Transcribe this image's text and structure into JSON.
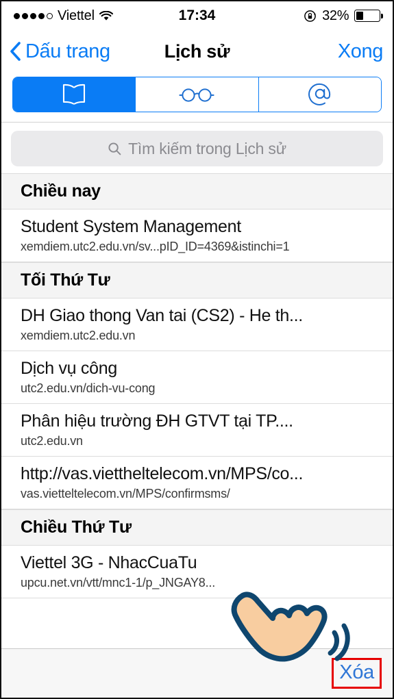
{
  "status_bar": {
    "signal_dots_filled": 4,
    "signal_dots_total": 5,
    "carrier": "Viettel",
    "wifi_icon": "wifi-icon",
    "time": "17:34",
    "rotation_lock_icon": "rotation-lock-icon",
    "battery_percent_label": "32%",
    "battery_level": 32
  },
  "nav_bar": {
    "back_label": "Dấu trang",
    "back_icon": "chevron-left-icon",
    "title": "Lịch sử",
    "done_label": "Xong"
  },
  "segmented_control": {
    "selected_index": 0,
    "accent_color": "#0a7cf5",
    "segments": [
      {
        "icon": "book-icon",
        "name": "bookmarks"
      },
      {
        "icon": "glasses-icon",
        "name": "reading-list"
      },
      {
        "icon": "at-sign-icon",
        "name": "shared-links"
      }
    ]
  },
  "search": {
    "icon": "search-icon",
    "placeholder": "Tìm kiếm trong Lịch sử",
    "value": ""
  },
  "history": {
    "sections": [
      {
        "header": "Chiều nay",
        "items": [
          {
            "title": "Student System Management",
            "url": "xemdiem.utc2.edu.vn/sv...pID_ID=4369&istinchi=1"
          }
        ]
      },
      {
        "header": "Tối Thứ Tư",
        "items": [
          {
            "title": "DH Giao thong Van tai (CS2) - He th...",
            "url": "xemdiem.utc2.edu.vn"
          },
          {
            "title": "Dịch vụ công",
            "url": "utc2.edu.vn/dich-vu-cong"
          },
          {
            "title": "Phân hiệu trường ĐH GTVT tại TP....",
            "url": "utc2.edu.vn"
          },
          {
            "title": "http://vas.viettheltelecom.vn/MPS/co...",
            "url": "vas.vietteltelecom.vn/MPS/confirmsms/"
          }
        ]
      },
      {
        "header": "Chiều Thứ Tư",
        "items": [
          {
            "title": "Viettel 3G - NhacCuaTu",
            "url": "upcu.net.vn/vtt/mnc1-1/p_JNGAY8..."
          }
        ]
      }
    ]
  },
  "toolbar": {
    "delete_label": "Xóa",
    "highlight_color": "#e60000"
  },
  "overlay": {
    "cursor_icon": "pointing-hand-cursor",
    "fill_color": "#f8cda0",
    "outline_color": "#0f466e"
  }
}
